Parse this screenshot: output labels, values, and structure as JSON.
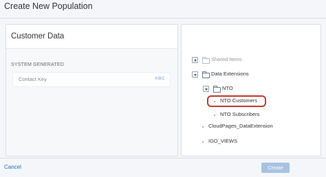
{
  "modal": {
    "title": "Create New Population"
  },
  "left_panel": {
    "title": "Customer Data",
    "section_label": "SYSTEM GENERATED",
    "fields": [
      {
        "name": "Contact Key",
        "type_badge": "ABC"
      }
    ]
  },
  "tree": {
    "items": [
      {
        "label": "Shared Items",
        "state": "collapsed",
        "icon": "folder-icon"
      },
      {
        "label": "Data Extensions",
        "state": "expanded",
        "icon": "folder-icon"
      },
      {
        "label": "NTO",
        "state": "expanded",
        "icon": "folder-icon"
      },
      {
        "label": "NTO Customers",
        "state": "highlighted",
        "icon": "bullet-icon"
      },
      {
        "label": "NTO Subscribers",
        "icon": "bullet-icon"
      },
      {
        "label": "CloudPages_DataExtension",
        "icon": "bullet-icon"
      },
      {
        "label": "IGO_VIEWS",
        "icon": "bullet-icon"
      }
    ]
  },
  "footer": {
    "cancel_label": "Cancel",
    "create_label": "Create"
  },
  "colors": {
    "highlight": "#c0392b",
    "link": "#1a6fb5",
    "primary_disabled": "#a6c3e2"
  }
}
